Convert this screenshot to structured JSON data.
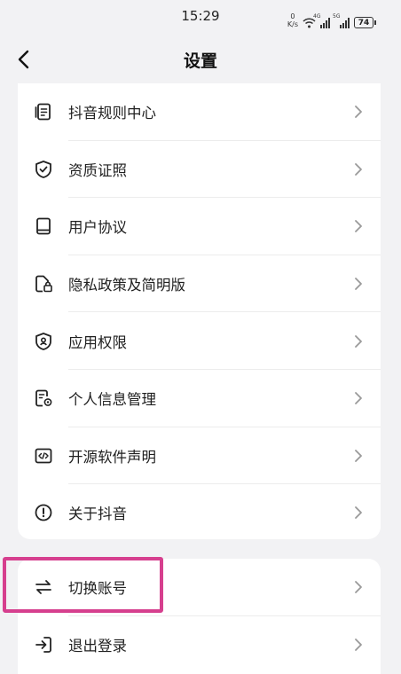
{
  "status_bar": {
    "time": "15:29",
    "net_speed_value": "0",
    "net_speed_unit": "K/s",
    "sim1_tag": "4G",
    "sim2_tag": "5G",
    "battery": "74"
  },
  "header": {
    "title": "设置"
  },
  "menu_group_1": [
    {
      "label": "抖音规则中心",
      "icon": "document-list-icon"
    },
    {
      "label": "资质证照",
      "icon": "shield-check-icon"
    },
    {
      "label": "用户协议",
      "icon": "book-icon"
    },
    {
      "label": "隐私政策及简明版",
      "icon": "document-lock-icon"
    },
    {
      "label": "应用权限",
      "icon": "shield-person-icon"
    },
    {
      "label": "个人信息管理",
      "icon": "document-gear-icon"
    },
    {
      "label": "开源软件声明",
      "icon": "code-icon"
    },
    {
      "label": "关于抖音",
      "icon": "info-circle-icon"
    }
  ],
  "menu_group_2": [
    {
      "label": "切换账号",
      "icon": "switch-arrows-icon"
    },
    {
      "label": "退出登录",
      "icon": "logout-icon"
    }
  ],
  "highlight_color": "#d63f8e"
}
